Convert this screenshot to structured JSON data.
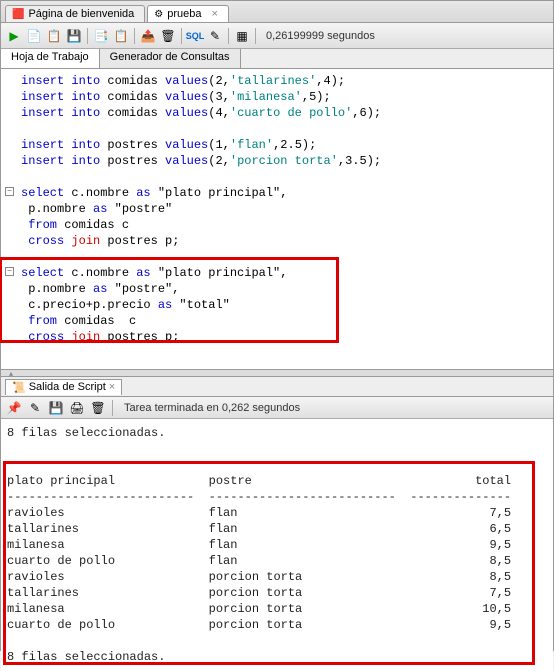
{
  "tabs": {
    "welcome": {
      "label": "Página de bienvenida",
      "icon": "🟥"
    },
    "active": {
      "label": "prueba",
      "icon": "⚙"
    }
  },
  "toolbar": {
    "run": "▶",
    "run_script": "📄",
    "explain": "📋",
    "commit": "💾",
    "rollback": "📑",
    "print": "📋",
    "export": "📤",
    "clear": "🗑",
    "sql": "SQL",
    "pencil": "✎",
    "grid": "▦",
    "time_label": "0,26199999 segundos"
  },
  "sub_tabs": {
    "worksheet": "Hoja de Trabajo",
    "builder": "Generador de Consultas"
  },
  "sql": {
    "l1": {
      "kw1": "insert",
      "kw2": "into",
      "tbl": " comidas ",
      "kw3": "values",
      "args": "(2,",
      "str": "'tallarines'",
      "rest": ",4);"
    },
    "l2": {
      "kw1": "insert",
      "kw2": "into",
      "tbl": " comidas ",
      "kw3": "values",
      "args": "(3,",
      "str": "'milanesa'",
      "rest": ",5);"
    },
    "l3": {
      "kw1": "insert",
      "kw2": "into",
      "tbl": " comidas ",
      "kw3": "values",
      "args": "(4,",
      "str": "'cuarto de pollo'",
      "rest": ",6);"
    },
    "l4": {
      "kw1": "insert",
      "kw2": "into",
      "tbl": " postres ",
      "kw3": "values",
      "args": "(1,",
      "str": "'flan'",
      "rest": ",2.5);"
    },
    "l5": {
      "kw1": "insert",
      "kw2": "into",
      "tbl": " postres ",
      "kw3": "values",
      "args": "(2,",
      "str": "'porcion torta'",
      "rest": ",3.5);"
    },
    "s1": {
      "kw": "select",
      "col": " c.nombre ",
      "as": "as",
      "alias": " \"plato principal\","
    },
    "s1b": {
      "col": " p.nombre ",
      "as": "as",
      "alias": " \"postre\""
    },
    "s1c": {
      "kw": " from",
      "rest": " comidas c"
    },
    "s1d": {
      "kw1": " cross",
      "kw2": "join",
      "rest": " postres p;"
    },
    "s2": {
      "kw": "select",
      "col": " c.nombre ",
      "as": "as",
      "alias": " \"plato principal\","
    },
    "s2b": {
      "col": " p.nombre ",
      "as": "as",
      "alias": " \"postre\","
    },
    "s2c": {
      "col": " c.precio+p.precio ",
      "as": "as",
      "alias": " \"total\""
    },
    "s2d": {
      "kw": " from",
      "rest": " comidas  c"
    },
    "s2e": {
      "kw1": " cross",
      "kw2": "join",
      "rest": " postres p;"
    }
  },
  "output_tab": {
    "label": "Salida de Script",
    "close": "×"
  },
  "output_toolbar": {
    "pin": "📌",
    "pencil": "✎",
    "save": "💾",
    "print": "🖨",
    "trash": "🗑",
    "status": "Tarea terminada en 0,262 segundos"
  },
  "chart_data": {
    "type": "table",
    "pre_text": "8 filas seleccionadas.",
    "columns": [
      "plato principal",
      "postre",
      "total"
    ],
    "rows": [
      [
        "ravioles",
        "flan",
        "7,5"
      ],
      [
        "tallarines",
        "flan",
        "6,5"
      ],
      [
        "milanesa",
        "flan",
        "9,5"
      ],
      [
        "cuarto de pollo",
        "flan",
        "8,5"
      ],
      [
        "ravioles",
        "porcion torta",
        "8,5"
      ],
      [
        "tallarines",
        "porcion torta",
        "7,5"
      ],
      [
        "milanesa",
        "porcion torta",
        "10,5"
      ],
      [
        "cuarto de pollo",
        "porcion torta",
        "9,5"
      ]
    ],
    "post_text": "8 filas seleccionadas."
  }
}
